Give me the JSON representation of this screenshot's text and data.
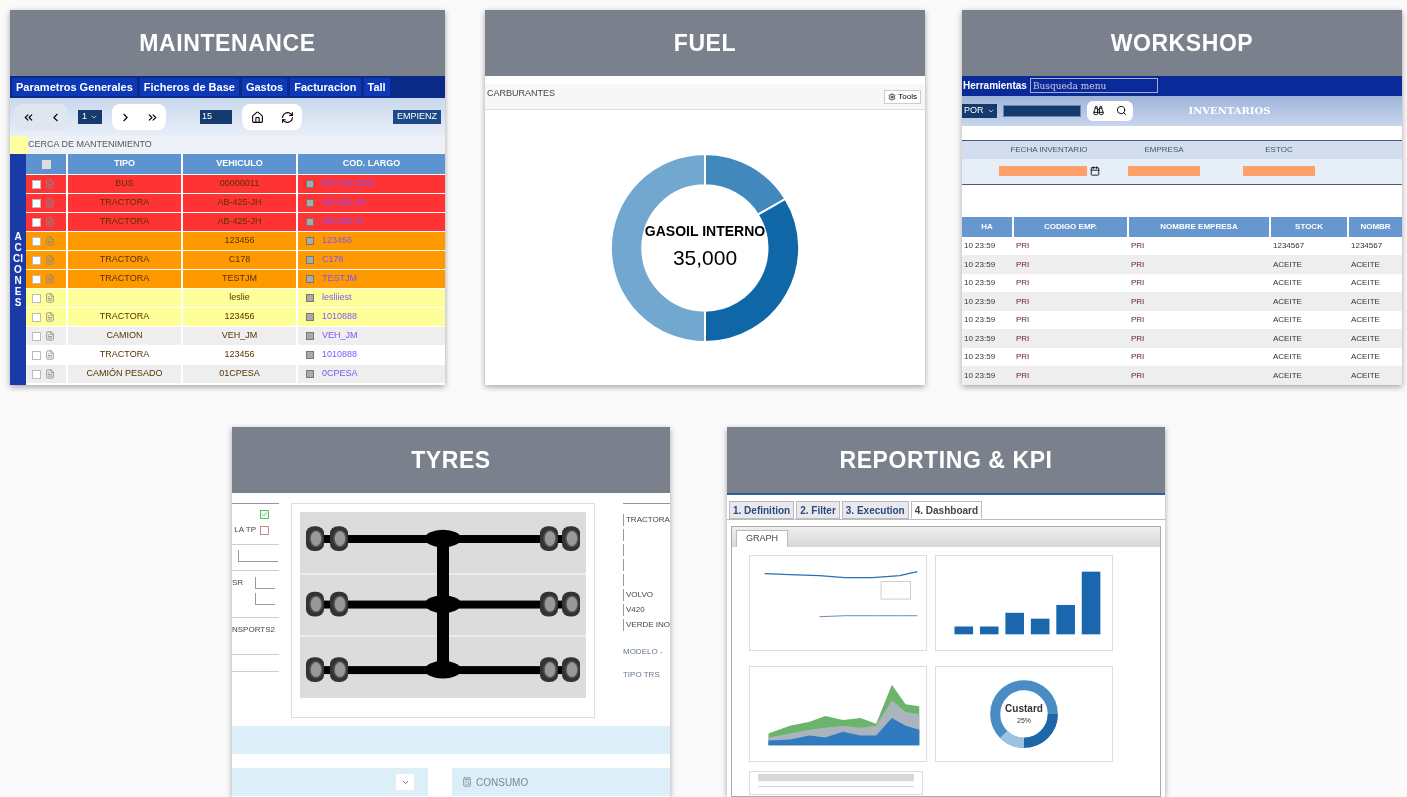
{
  "maintenance": {
    "title": "MAINTENANCE",
    "menu": [
      "Parametros Generales",
      "Ficheros de Base",
      "Gastos",
      "Facturacion",
      "Tall"
    ],
    "toolbar": {
      "page": "1",
      "page_size": "15",
      "start_button": "EMPIENZ"
    },
    "section_label": "CERCA DE MANTENIMIENTO",
    "side_label": "ACCIONES",
    "columns": [
      "TIPO",
      "VEHICULO",
      "COD. LARGO"
    ],
    "select_all_checked": false,
    "rows": [
      {
        "tipo": "BUS",
        "vehiculo": "00000011",
        "cod": "INT-VALUES",
        "color": "#ff3333",
        "checked": false
      },
      {
        "tipo": "TRACTORA",
        "vehiculo": "AB-425-JH",
        "cod": "AB-425-JH",
        "color": "#ff3333",
        "checked": false
      },
      {
        "tipo": "TRACTORA",
        "vehiculo": "AB-425-JH",
        "cod": "AB-425-JI",
        "color": "#ff3333",
        "checked": false
      },
      {
        "vehiculo": "123456",
        "cod": "123456",
        "color": "#ff9900",
        "checked": false
      },
      {
        "tipo": "TRACTORA",
        "vehiculo": "C178",
        "cod": "C178",
        "color": "#ff9900",
        "checked": false
      },
      {
        "tipo": "TRACTORA",
        "vehiculo": "TESTJM",
        "cod": "TESTJM",
        "color": "#ff9900",
        "checked": false
      },
      {
        "vehiculo": "leslie",
        "cod": "lesliiest",
        "color": "#ffff99",
        "checked": false
      },
      {
        "tipo": "TRACTORA",
        "vehiculo": "123456",
        "cod": "1010888",
        "color": "#ffff99",
        "checked": false
      },
      {
        "tipo": "CAMION",
        "vehiculo": "VEH_JM",
        "cod": "VEH_JM",
        "color": "#eeeeee",
        "checked": false
      },
      {
        "tipo": "TRACTORA",
        "vehiculo": "123456",
        "cod": "1010888",
        "color": "#ffffff",
        "checked": false
      },
      {
        "tipo": "CAMIÓN PESADO",
        "vehiculo": "01CPESA",
        "cod": "0CPESA",
        "color": "#eeeeee",
        "checked": false
      }
    ]
  },
  "fuel": {
    "title": "FUEL",
    "panel_title": "CARBURANTES",
    "tools_button": "Tools",
    "donut_label": "GASOIL INTERNO",
    "donut_value": "35,000"
  },
  "workshop": {
    "title": "WORKSHOP",
    "menu_label": "Herramientas",
    "search": {
      "placeholder": "Busqueda menu"
    },
    "filter_select": "POR",
    "page_title": "INVENTARIOS",
    "filter_columns": [
      "FECHA INVENTARIO",
      "EMPRESA",
      "ESTOC"
    ],
    "columns": [
      "HA",
      "CODIGO EMP.",
      "NOMBRE EMPRESA",
      "STOCK",
      "NOMBR"
    ],
    "rows": [
      [
        "10 23:59",
        "PRI",
        "PRI",
        "1234567",
        "1234567"
      ],
      [
        "10 23:59",
        "PRI",
        "PRI",
        "ACEITE",
        "ACEITE"
      ],
      [
        "10 23:59",
        "PRI",
        "PRI",
        "ACEITE",
        "ACEITE"
      ],
      [
        "10 23:59",
        "PRI",
        "PRI",
        "ACEITE",
        "ACEITE"
      ],
      [
        "10 23:59",
        "PRI",
        "PRI",
        "ACEITE",
        "ACEITE"
      ],
      [
        "10 23:59",
        "PRI",
        "PRI",
        "ACEITE",
        "ACEITE"
      ],
      [
        "10 23:59",
        "PRI",
        "PRI",
        "ACEITE",
        "ACEITE"
      ],
      [
        "10 23:59",
        "PRI",
        "PRI",
        "ACEITE",
        "ACEITE"
      ]
    ]
  },
  "tyres": {
    "title": "TYRES",
    "checkboxes": [
      {
        "checked": true
      },
      {
        "label": "LA TP",
        "checked": false
      }
    ],
    "left_labels": [
      "SR",
      "NSPORTS2"
    ],
    "right_fields": [
      "TRACTORA",
      "VOLVO",
      "V420",
      "VERDE INO"
    ],
    "right_labels": [
      "MODELO -",
      "TIPO TRS"
    ],
    "consumption_button": "CONSUMO"
  },
  "reporting": {
    "title": "REPORTING & KPI",
    "tabs": [
      {
        "label": "1. Definition",
        "selected": false
      },
      {
        "label": "2. Filter",
        "selected": false
      },
      {
        "label": "3. Execution",
        "selected": false
      },
      {
        "label": "4. Dashboard",
        "selected": true
      }
    ],
    "inner_tab": "GRAPH",
    "donut_label": "Custard",
    "donut_value": "25%"
  }
}
